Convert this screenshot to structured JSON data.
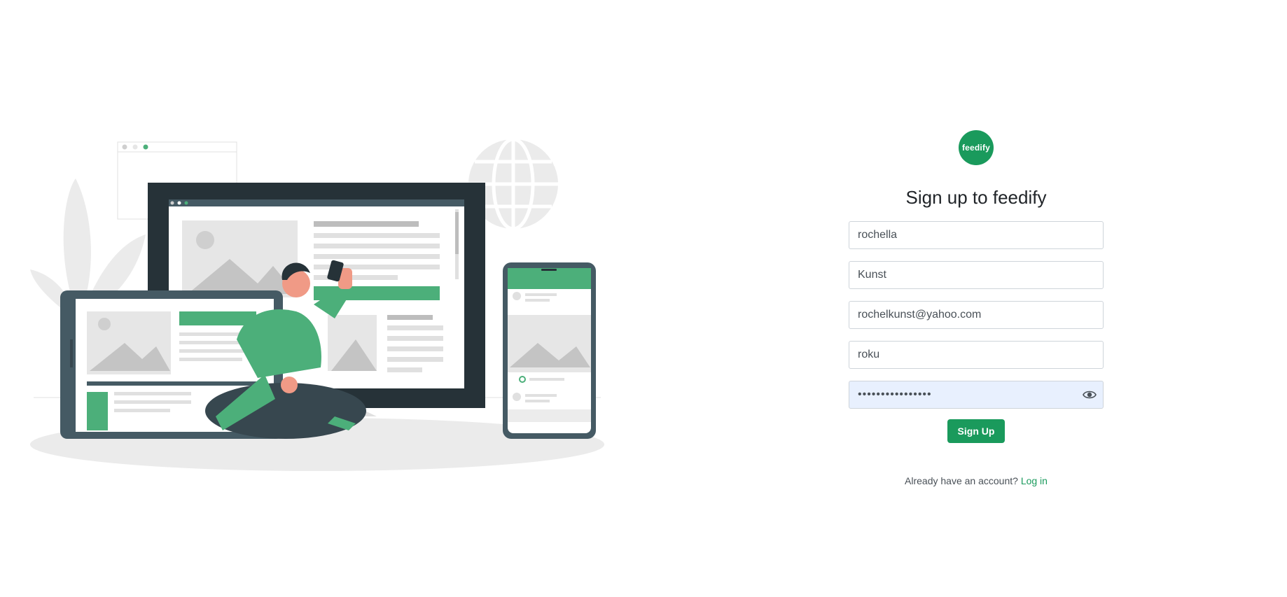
{
  "brand": {
    "logo_text": "feedify",
    "accent_color": "#1a9a5c"
  },
  "form": {
    "title": "Sign up to feedify",
    "first_name_value": "rochella",
    "last_name_value": "Kunst",
    "email_value": "rochelkunst@yahoo.com",
    "username_value": "roku",
    "password_value": "roku1234roku1234",
    "submit_label": "Sign Up"
  },
  "footer": {
    "prompt": "Already have an account?",
    "login_link": "Log in"
  },
  "icons": {
    "password_toggle": "eye-icon"
  }
}
